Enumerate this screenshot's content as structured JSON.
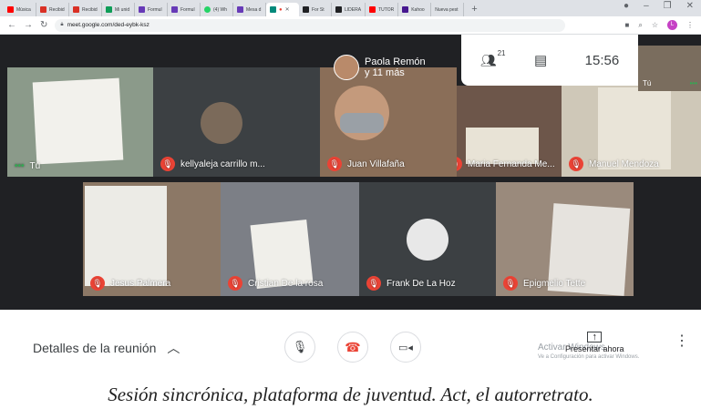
{
  "browser": {
    "tabs": [
      {
        "label": "Música",
        "color": "#ff0000"
      },
      {
        "label": "Recibid",
        "color": "#d93025"
      },
      {
        "label": "Recibid",
        "color": "#d93025"
      },
      {
        "label": "Mi unid",
        "color": "#0f9d58"
      },
      {
        "label": "Formul",
        "color": "#673ab7"
      },
      {
        "label": "Formul",
        "color": "#673ab7"
      },
      {
        "label": "(4) Wh",
        "color": "#25d366"
      },
      {
        "label": "Mesa d",
        "color": "#673ab7"
      },
      {
        "label": "",
        "color": "#00897b",
        "active": true
      },
      {
        "label": "For St",
        "color": "#202124"
      },
      {
        "label": "LIDERA",
        "color": "#202124"
      },
      {
        "label": "TUTOR",
        "color": "#ff0000"
      },
      {
        "label": "Kahoo",
        "color": "#46178f"
      },
      {
        "label": "Nueva pest",
        "color": "#ffffff"
      }
    ],
    "url": "meet.google.com/ded-eybk-ksz"
  },
  "meet": {
    "presenter_name": "Paola Remón",
    "presenter_more": "y 11 más",
    "participant_count": "21",
    "clock": "15:56",
    "self_label": "Tú",
    "tiles": [
      {
        "name": "Tú"
      },
      {
        "name": "kellyaleja carrillo m..."
      },
      {
        "name": "Juan Villafaña"
      },
      {
        "name": "Maria Fernanda Me..."
      },
      {
        "name": "Manuel Mendoza"
      },
      {
        "name": "Jesus Palmera"
      },
      {
        "name": "Cristian De la rosa"
      },
      {
        "name": "Frank De La Hoz"
      },
      {
        "name": "Epigmelio Tette"
      }
    ]
  },
  "controls": {
    "details_label": "Detalles de la reunión",
    "activate_title": "Activar Windows",
    "activate_sub": "Ve a Configuración para activar Windows.",
    "present_label": "Presentar ahora"
  },
  "caption": "Sesión  sincrónica, plataforma de juventud. Act, el autorretrato."
}
